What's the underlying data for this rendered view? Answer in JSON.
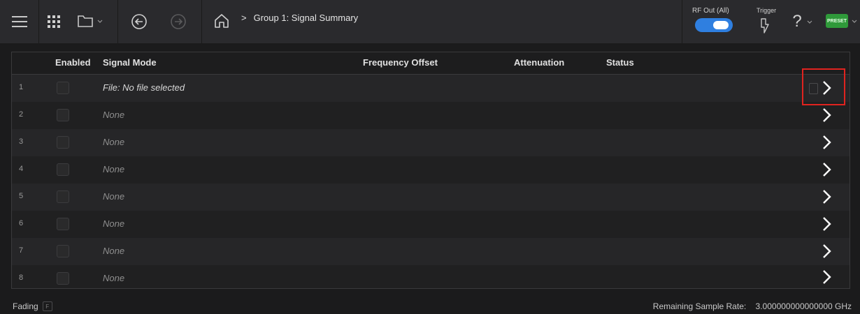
{
  "toolbar": {
    "menu_icon": "hamburger-menu-icon",
    "apps_icon": "grid-apps-icon",
    "folder_icon": "folder-icon",
    "back_icon": "back-arrow-icon",
    "forward_icon": "forward-arrow-icon",
    "home_icon": "home-icon",
    "breadcrumb_sep": ">",
    "breadcrumb_title": "Group 1: Signal Summary",
    "rf_out_label": "RF Out (All)",
    "rf_out_state": "on",
    "trigger_label": "Trigger",
    "help_symbol": "?",
    "preset_label": "PRESET"
  },
  "table": {
    "headers": {
      "enabled": "Enabled",
      "signal_mode": "Signal Mode",
      "frequency_offset": "Frequency Offset",
      "attenuation": "Attenuation",
      "status": "Status"
    },
    "rows": [
      {
        "num": "1",
        "mode": "File: No file selected"
      },
      {
        "num": "2",
        "mode": "None"
      },
      {
        "num": "3",
        "mode": "None"
      },
      {
        "num": "4",
        "mode": "None"
      },
      {
        "num": "5",
        "mode": "None"
      },
      {
        "num": "6",
        "mode": "None"
      },
      {
        "num": "7",
        "mode": "None"
      },
      {
        "num": "8",
        "mode": "None"
      }
    ]
  },
  "footer": {
    "fading_label": "Fading",
    "fading_box": "F",
    "remaining_label": "Remaining Sample Rate:",
    "remaining_value": "3.000000000000000 GHz"
  },
  "colors": {
    "accent": "#2f7fe0",
    "preset": "#2f9a3a",
    "highlight": "#e0231f"
  }
}
